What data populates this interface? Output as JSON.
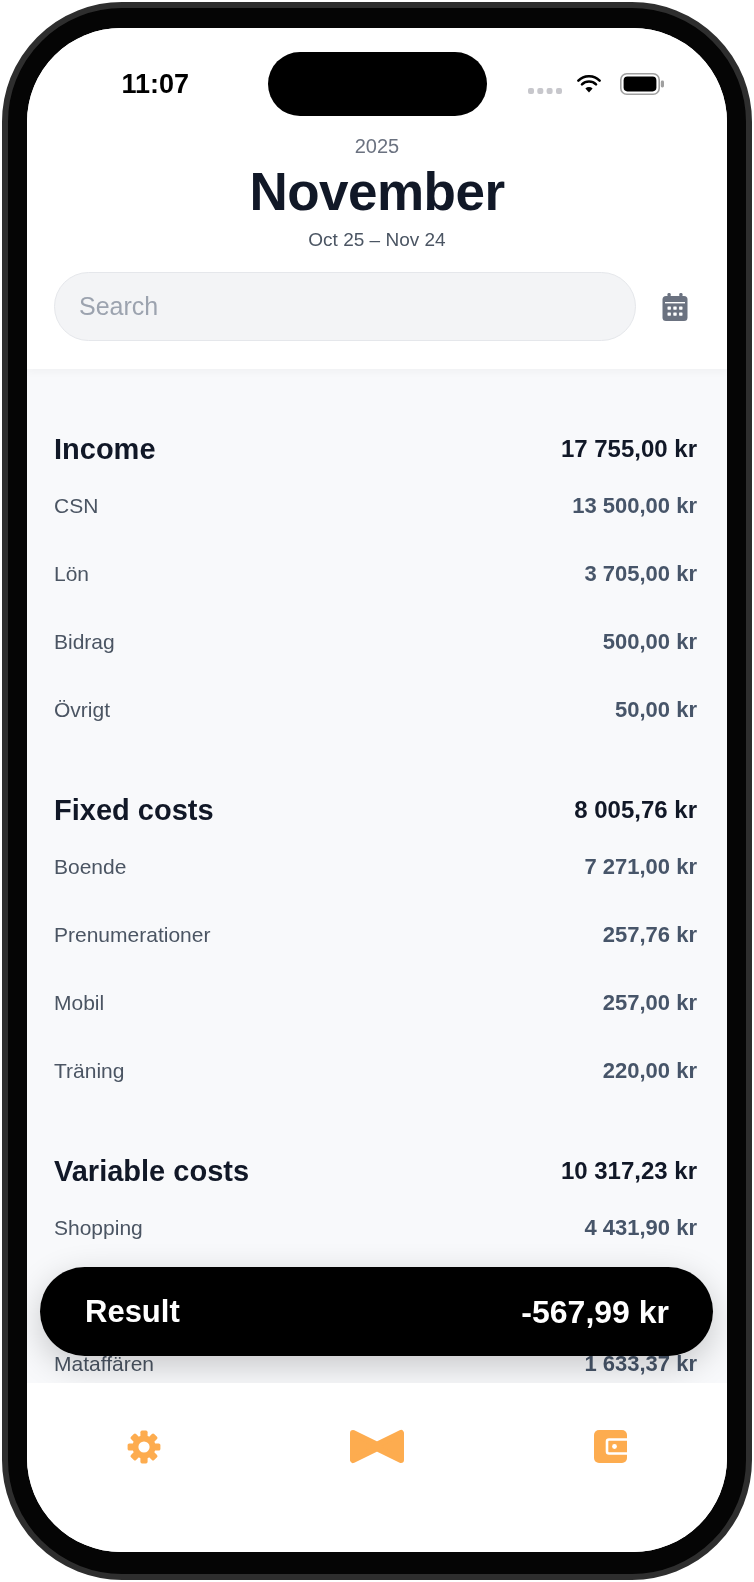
{
  "status_bar": {
    "time": "11:07"
  },
  "header": {
    "year": "2025",
    "month": "November",
    "period": "Oct 25 – Nov 24"
  },
  "search": {
    "placeholder": "Search"
  },
  "sections": [
    {
      "title": "Income",
      "total": "17 755,00 kr",
      "rows": [
        {
          "label": "CSN",
          "amount": "13 500,00 kr"
        },
        {
          "label": "Lön",
          "amount": "3 705,00 kr"
        },
        {
          "label": "Bidrag",
          "amount": "500,00 kr"
        },
        {
          "label": "Övrigt",
          "amount": "50,00 kr"
        }
      ]
    },
    {
      "title": "Fixed costs",
      "total": "8 005,76 kr",
      "rows": [
        {
          "label": "Boende",
          "amount": "7 271,00 kr"
        },
        {
          "label": "Prenumerationer",
          "amount": "257,76 kr"
        },
        {
          "label": "Mobil",
          "amount": "257,00 kr"
        },
        {
          "label": "Träning",
          "amount": "220,00 kr"
        }
      ]
    },
    {
      "title": "Variable costs",
      "total": "10 317,23 kr",
      "rows": [
        {
          "label": "Shopping",
          "amount": "4 431,90 kr"
        },
        {
          "label": "Mataffären",
          "amount": "1 633,37 kr"
        }
      ]
    }
  ],
  "result": {
    "label": "Result",
    "value": "-567,99 kr"
  }
}
